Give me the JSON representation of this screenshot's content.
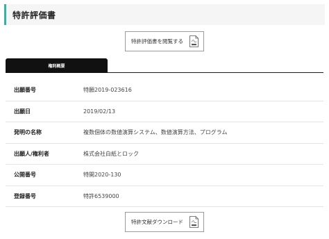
{
  "header": {
    "title": "特許評価書"
  },
  "view_button": {
    "label": "特許評価書を閲覧する",
    "icon": "pdf-file-icon"
  },
  "tabs": [
    {
      "label": "権利概要",
      "active": true
    }
  ],
  "details": [
    {
      "key": "出願番号",
      "value": "特願2019-023616"
    },
    {
      "key": "出願日",
      "value": "2019/02/13"
    },
    {
      "key": "発明の名称",
      "value": "複数個体の数値演算システム、数値演算方法、プログラム"
    },
    {
      "key": "出願人/権利者",
      "value": "株式会社白紙とロック"
    },
    {
      "key": "公開番号",
      "value": "特開2020-130"
    },
    {
      "key": "登録番号",
      "value": "特許6539000"
    }
  ],
  "download_button": {
    "label": "特許文献ダウンロード",
    "icon": "pdf-file-icon"
  },
  "colors": {
    "accent": "#2fb5a8",
    "tab_bg": "#111111",
    "header_bg": "#f5f5f5"
  }
}
